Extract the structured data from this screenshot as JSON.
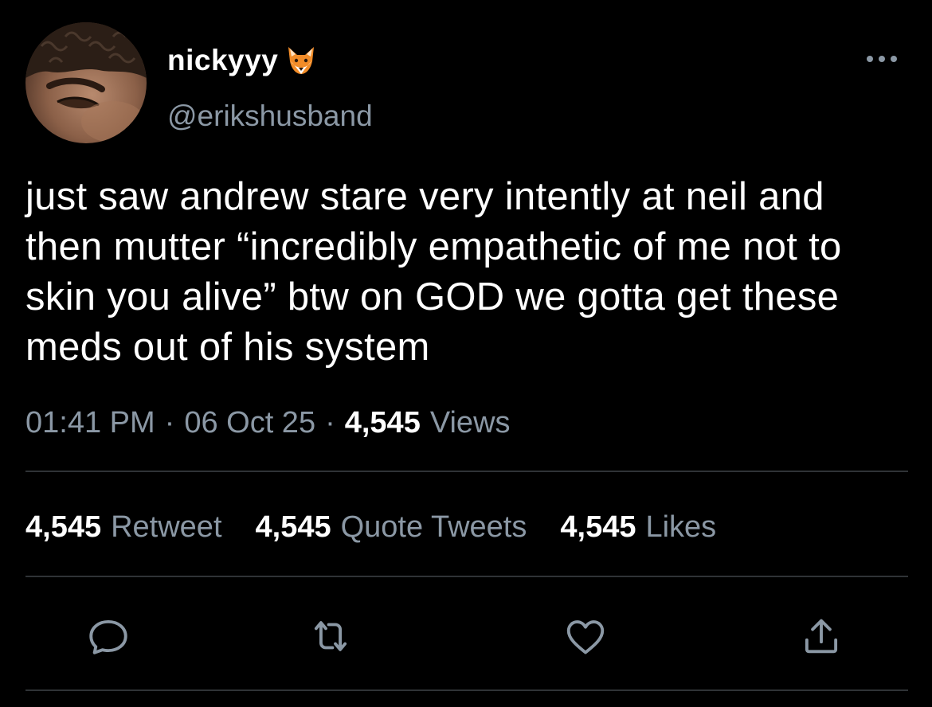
{
  "user": {
    "display_name": "nickyyy",
    "handle": "@erikshusband",
    "name_emoji": "fox-face-icon"
  },
  "tweet": {
    "text": "just saw andrew stare very intently at neil and then mutter “incredibly empathetic of me not to skin you alive” btw on GOD we gotta get these meds out of his system",
    "time": "01:41 PM",
    "date": "06 Oct 25",
    "separator": "·",
    "views_count": "4,545",
    "views_label": "Views"
  },
  "stats": {
    "retweets_count": "4,545",
    "retweets_label": "Retweet",
    "quotes_count": "4,545",
    "quotes_label": "Quote Tweets",
    "likes_count": "4,545",
    "likes_label": "Likes"
  },
  "actions": {
    "reply_icon": "reply-icon",
    "retweet_icon": "retweet-icon",
    "like_icon": "heart-icon",
    "share_icon": "share-icon",
    "more_icon": "more-icon"
  },
  "colors": {
    "background": "#000000",
    "primary_text": "#ffffff",
    "secondary_text": "#8b98a5",
    "divider": "#2f3336",
    "icon": "#8b98a5"
  }
}
